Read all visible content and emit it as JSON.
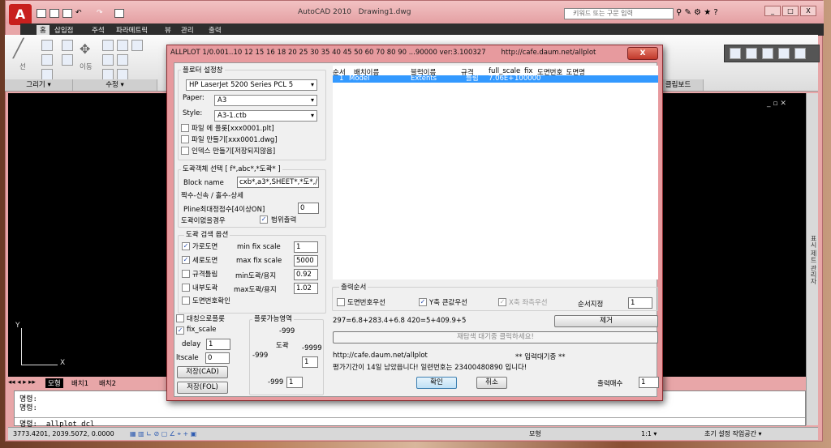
{
  "app": {
    "title": "AutoCAD 2010",
    "document": "Drawing1.dwg",
    "search_placeholder": "키워드 또는 구문 입력",
    "logo": "A"
  },
  "ribbon": {
    "tabs": [
      "홈",
      "삽입점",
      "주석",
      "파라메트릭",
      "뷰",
      "관리",
      "출력"
    ],
    "panels": [
      "그리기 ▾",
      "수정 ▾",
      "클립보드"
    ],
    "labels": {
      "line": "선",
      "move": "이동"
    }
  },
  "side_panel": {
    "label": "표시 제트 관리자"
  },
  "layout_tabs": [
    "모형",
    "배치1",
    "배치2"
  ],
  "command_line": {
    "lines": [
      "명령:",
      "명령:"
    ],
    "current": "명령:  _allplot_dcl"
  },
  "status_bar": {
    "coords": "3773.4201, 2039.5072, 0.0000",
    "model": "모형",
    "scale": "1:1 ▾",
    "workspace": "초기 설정 작업공간 ▾"
  },
  "dialog": {
    "title": "ALLPLOT 1/0.001..10 12 15 16 18 20 25 30 35 40 45 50 60 70 80 90 ...90000 ver:3.100327",
    "url_title": "http://cafe.daum.net/allplot",
    "close": "X",
    "plotter": {
      "group": "플로터 설정창",
      "device": "HP LaserJet 5200 Series PCL 5",
      "paper_label": "Paper:",
      "paper": "A3",
      "style_label": "Style:",
      "style": "A3-1.ctb",
      "options": [
        {
          "label": "파일 에 플롯[xxx0001.plt]",
          "checked": false
        },
        {
          "label": "파일 만들기[xxx0001.dwg]",
          "checked": false
        },
        {
          "label": "인덱스 만들기[저장되지않음]",
          "checked": false
        }
      ]
    },
    "select": {
      "group": "도곽객체 선택 [ f*,abc*,*도곽* ]",
      "block_label": "Block name",
      "block_value": "cxb*,a3*,SHEET*,*도*,/",
      "note": "짝수-신속 / 홀수-상세",
      "pline_label": "Pline최대정점수[4이상ON]",
      "pline_value": "0",
      "noframe_label": "도곽이없을경우",
      "range_label": "범위출력",
      "range_checked": true
    },
    "search": {
      "group": "도곽 검색 옵션",
      "checks": [
        {
          "label": "가로도면",
          "checked": true
        },
        {
          "label": "세로도면",
          "checked": true
        },
        {
          "label": "규격틀림",
          "checked": false
        },
        {
          "label": "내부도곽",
          "checked": false
        },
        {
          "label": "도면번호확인",
          "checked": false
        }
      ],
      "fields": [
        {
          "label": "min fix scale",
          "value": "1"
        },
        {
          "label": "max fix scale",
          "value": "5000"
        },
        {
          "label": "min도곽/용지",
          "value": "0.92"
        },
        {
          "label": "max도곽/용지",
          "value": "1.02"
        }
      ]
    },
    "misc": {
      "symmetric": "대칭으로플롯",
      "symmetric_checked": false,
      "fix_scale": "fix_scale",
      "fix_checked": true,
      "delay_label": "delay",
      "delay": "1",
      "ltscale_label": "ltscale",
      "ltscale": "0",
      "save_cad": "저장(CAD)",
      "save_fol": "저장(FOL)"
    },
    "area": {
      "group": "플롯가능영역",
      "top": "-999",
      "left": "-999",
      "right": "-9999",
      "bottom": "-999",
      "center": "도곽",
      "right_value": "1",
      "bottom_value": "1"
    },
    "list": {
      "headers": [
        "순서",
        "배치이름",
        "블럭이름",
        "규격",
        "full_scale",
        "fix",
        "도면번호_도면명"
      ],
      "rows": [
        [
          "1",
          "Model",
          "Extents",
          "틀림",
          "7.06E+",
          "100000",
          ""
        ]
      ]
    },
    "order": {
      "group": "출력순서",
      "options": [
        {
          "label": "도면번호우선",
          "checked": false,
          "disabled": false
        },
        {
          "label": "Y축 큰값우선",
          "checked": true,
          "disabled": false
        },
        {
          "label": "X축 좌측우선",
          "checked": true,
          "disabled": true
        }
      ],
      "assign_label": "순서지정",
      "assign_value": "1"
    },
    "formula": "297=6.8+283.4+6.8  420=5+409.9+5",
    "remove": "제거",
    "rescan": "재탐색 대기중 클릭하세요!",
    "url": "http://cafe.daum.net/allplot",
    "waiting": "** 입력대기중 **",
    "trial": "평가기간이 14일 남았읍니다! 일련번호는  23400480890  입니다!",
    "ok": "확인",
    "cancel": "취소",
    "copies_label": "출력매수",
    "copies": "1"
  }
}
